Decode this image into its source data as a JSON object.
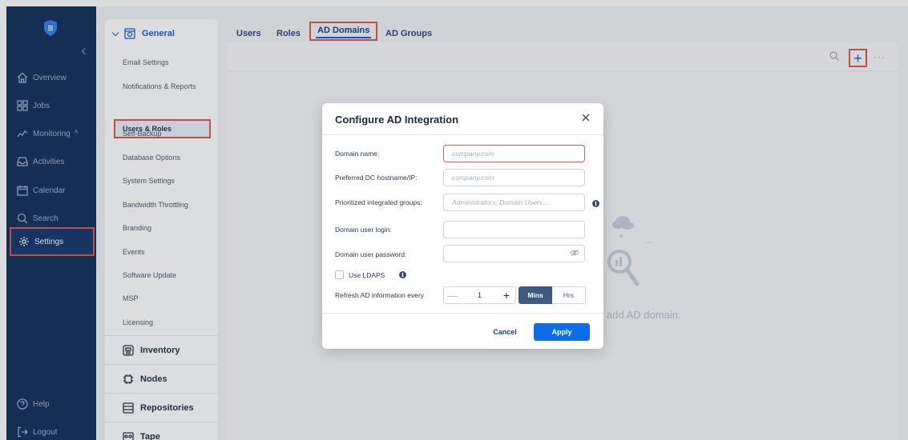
{
  "nav": {
    "items": [
      {
        "label": "Overview",
        "icon": "home-icon"
      },
      {
        "label": "Jobs",
        "icon": "grid-icon"
      },
      {
        "label": "Monitoring",
        "icon": "chart-line-icon"
      },
      {
        "label": "Activities",
        "icon": "inbox-icon"
      },
      {
        "label": "Calendar",
        "icon": "calendar-icon"
      },
      {
        "label": "Search",
        "icon": "search-icon"
      },
      {
        "label": "Settings",
        "icon": "gear-icon"
      },
      {
        "label": "Help",
        "icon": "help-icon"
      },
      {
        "label": "Logout",
        "icon": "logout-icon"
      }
    ],
    "monitoring_chevron": "^"
  },
  "settings": {
    "general": "General",
    "sub_items": [
      "Email Settings",
      "Notifications & Reports",
      "Users & Roles",
      "Self-Backup",
      "Database Options",
      "System Settings",
      "Bandwidth Throttling",
      "Branding",
      "Events",
      "Software Update",
      "MSP",
      "Licensing"
    ],
    "sections": [
      "Inventory",
      "Nodes",
      "Repositories",
      "Tape"
    ]
  },
  "tabs": [
    "Users",
    "Roles",
    "AD Domains",
    "AD Groups"
  ],
  "toolbar": {
    "add": "+",
    "more": "···"
  },
  "empty_state": {
    "text": "add AD domain."
  },
  "dialog": {
    "title": "Configure AD Integration",
    "fields": {
      "domain_name": {
        "label": "Domain name:",
        "placeholder": "company.com"
      },
      "preferred_dc": {
        "label": "Preferred DC hostname/IP:",
        "placeholder": "company.com"
      },
      "groups": {
        "label": "Prioritized integrated groups:",
        "placeholder": "Administrators, Domain Users..."
      },
      "login": {
        "label": "Domain user login:",
        "value": ""
      },
      "password": {
        "label": "Domain user password:",
        "value": ""
      }
    },
    "ldaps": {
      "label": "Use LDAPS",
      "checked": false
    },
    "refresh": {
      "label": "Refresh AD information every",
      "value": "1",
      "minus": "—",
      "plus": "+",
      "unit_on": "Mins",
      "unit_off": "Hrs"
    },
    "cancel": "Cancel",
    "apply": "Apply",
    "info": "i"
  },
  "colors": {
    "nav_bg": "#0b2a57",
    "accent": "#0b6ee8",
    "highlight": "#d9534f"
  }
}
